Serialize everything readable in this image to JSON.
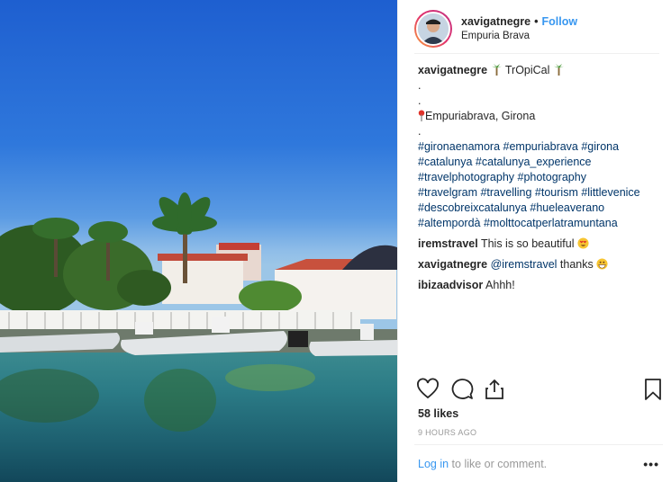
{
  "post": {
    "username": "xavigatnegre",
    "separator": "•",
    "follow_label": "Follow",
    "location": "Empuria Brava"
  },
  "caption": {
    "username": "xavigatnegre",
    "title": "TrOpiCal",
    "dot1": ".",
    "dot2": ".",
    "place": "Empuriabrava, Girona",
    "dot3": ".",
    "hashtag_lines": [
      "#gironaenamora #empuriabrava #girona",
      "#catalunya #catalunya_experience",
      "#travelphotography #photography",
      "#travelgram #travelling #tourism #littlevenice",
      "#descobreixcatalunya #hueleaverano",
      "#altempordà #molttocatperlatramuntana"
    ]
  },
  "comments": [
    {
      "username": "iremstravel",
      "text": "This is so beautiful"
    },
    {
      "username": "xavigatnegre",
      "mention": "@iremstravel",
      "text": "thanks"
    },
    {
      "username": "ibizaadvisor",
      "text": "Ahhh!"
    }
  ],
  "likes": "58 likes",
  "time_ago": "9 HOURS AGO",
  "login": {
    "link": "Log in",
    "rest": "to like or comment."
  },
  "more": "•••",
  "icons": {
    "like": "heart-icon",
    "comment": "comment-icon",
    "share": "share-icon",
    "save": "bookmark-icon"
  },
  "colors": {
    "link": "#3897f0",
    "hashtag": "#003569",
    "muted": "#999999"
  }
}
